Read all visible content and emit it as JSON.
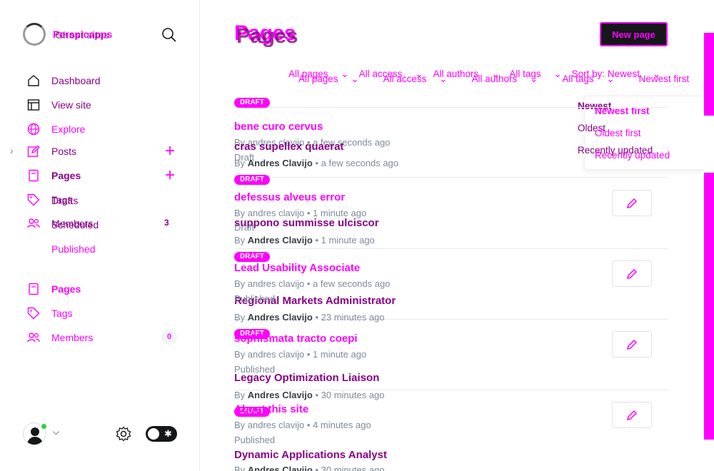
{
  "brand": {
    "name": "Perspicapps",
    "name_ghost": "Ghost sites"
  },
  "sidebar": {
    "items": [
      {
        "label": "Dashboard",
        "icon": "home-icon"
      },
      {
        "label": "View site",
        "icon": "window-icon"
      },
      {
        "label": "Explore",
        "icon": "globe-icon"
      },
      {
        "label": "Posts",
        "icon": "pencil-square-icon"
      },
      {
        "label": "Pages",
        "icon": "page-icon"
      },
      {
        "label": "Tags",
        "icon": "tag-icon"
      },
      {
        "label": "Members",
        "icon": "members-icon",
        "count": "3"
      }
    ],
    "ghost_items": [
      {
        "label": "Drafts"
      },
      {
        "label": "Scheduled"
      },
      {
        "label": "Published"
      },
      {
        "label": "Pages"
      },
      {
        "label": "Tags"
      },
      {
        "label": "Members",
        "count": "0"
      }
    ]
  },
  "header": {
    "title": "Pages",
    "new_button": "New page"
  },
  "filters": {
    "row1": [
      "All pages",
      "All access",
      "All authors",
      "All tags",
      "Sort by: Newest"
    ],
    "row2": [
      "All pages",
      "All access",
      "All authors",
      "All tags",
      "Newest first"
    ]
  },
  "sort_dropdown": {
    "items1": [
      "Newest",
      "Oldest",
      "Recently updated"
    ],
    "items2": [
      "Newest first",
      "Oldest first",
      "Recently updated"
    ]
  },
  "pages_a": [
    {
      "badge": "DRAFT",
      "title": "bene curo cervus",
      "meta": "By andres clavijo • a few seconds ago"
    },
    {
      "badge": "DRAFT",
      "title": "defessus alveus error",
      "meta": "By andres clavijo • 1 minute ago"
    },
    {
      "badge": "DRAFT",
      "title": "Lead Usability Associate",
      "meta": "By andres clavijo • a few seconds ago"
    },
    {
      "badge": "DRAFT",
      "title": "sophismata tracto coepi",
      "meta": "By andres clavijo • 1 minute ago"
    },
    {
      "badge": "DRAFT",
      "title": "About this site",
      "meta": "By andres clavijo • 4 minutes ago"
    }
  ],
  "pages_b": [
    {
      "title": "cras supellex quaerat",
      "status": "Draft",
      "author": "Andres Clavijo",
      "time": "• a few seconds ago"
    },
    {
      "title": "suppono summisse ulciscor",
      "status": "Draft",
      "author": "Andres Clavijo",
      "time": "• 1 minute ago"
    },
    {
      "title": "Regional Markets Administrator",
      "status": "Published",
      "author": "Andres Clavijo",
      "time": "• 23 minutes ago"
    },
    {
      "title": "Legacy Optimization Liaison",
      "status": "Published",
      "author": "Andres Clavijo",
      "time": "• 30 minutes ago"
    },
    {
      "title": "Dynamic Applications Analyst",
      "status": "Published",
      "author": "Andres Clavijo",
      "time": "• 30 minutes ago"
    }
  ],
  "by_label": "By",
  "colors": {
    "accent": "#ff00ff",
    "accent_dark": "#880088",
    "text": "#15171a",
    "muted": "#7c8b9a"
  }
}
